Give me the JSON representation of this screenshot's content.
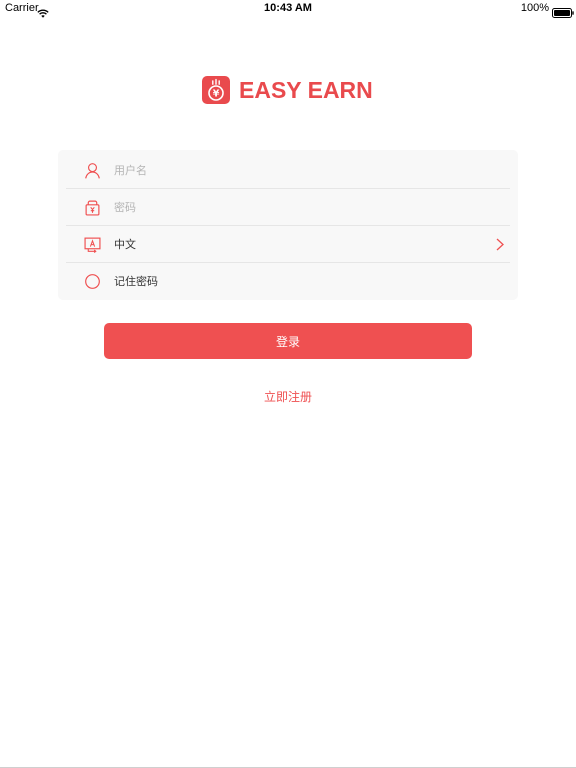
{
  "status_bar": {
    "carrier": "Carrier",
    "time": "10:43 AM",
    "battery": "100%"
  },
  "logo": {
    "text": "EASY EARN",
    "icon_glyph": "¥"
  },
  "form": {
    "username": {
      "placeholder": "用户名",
      "value": ""
    },
    "password": {
      "placeholder": "密码",
      "value": ""
    },
    "language": {
      "value": "中文"
    },
    "remember": {
      "label": "记住密码",
      "checked": false
    }
  },
  "login_button": {
    "label": "登录"
  },
  "register_link": {
    "label": "立即注册"
  },
  "colors": {
    "accent": "#ef5051",
    "logo": "#e94a4d",
    "card_background": "#f8f8f8",
    "divider": "#e6e6e6",
    "placeholder": "#b4b4b4",
    "text": "#333333"
  },
  "icons": {
    "status_wifi": "wifi-icon",
    "status_battery": "battery-icon",
    "logo": "coin-logo-icon",
    "username": "user-icon",
    "password": "lock-icon",
    "language": "language-icon",
    "language_arrow": "chevron-right-icon",
    "remember": "radio-circle-icon"
  }
}
